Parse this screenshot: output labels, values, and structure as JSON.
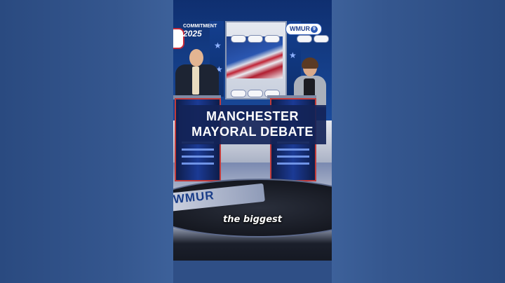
{
  "overlay": {
    "headline_line1": "MANCHESTER",
    "headline_line2": "MAYORAL DEBATE",
    "caption": "the biggest"
  },
  "station": {
    "corner_logo": "WMUR",
    "corner_logo_mark": "9",
    "stage_logo": "WMUR"
  },
  "event_logo": {
    "small_text": "COMMITMENT",
    "year": "2025"
  },
  "colors": {
    "background": "#2f4f86",
    "banner": "#132458",
    "accent_red": "#c23b3b",
    "accent_blue": "#1b3a95"
  }
}
